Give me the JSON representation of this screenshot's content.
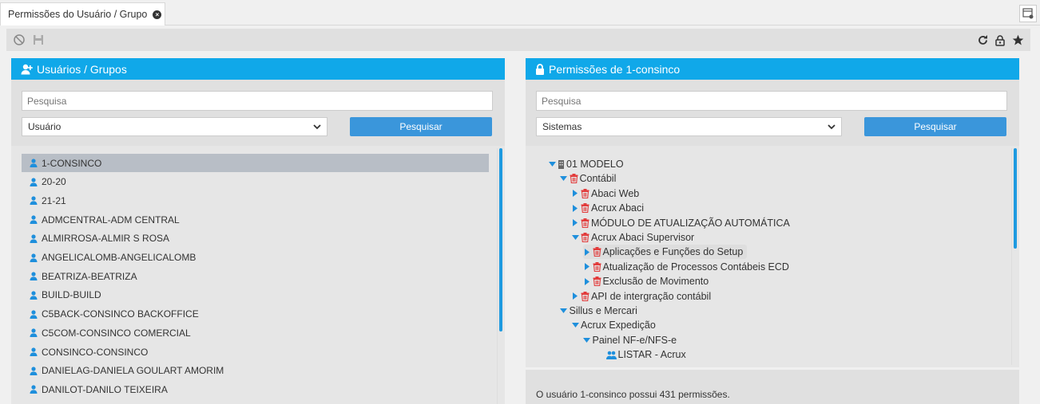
{
  "tab": {
    "title": "Permissões do Usuário / Grupo"
  },
  "left": {
    "title": "Usuários / Grupos",
    "search_placeholder": "Pesquisa",
    "select_value": "Usuário",
    "button": "Pesquisar",
    "users": [
      "1-CONSINCO",
      "20-20",
      "21-21",
      "ADMCENTRAL-ADM CENTRAL",
      "ALMIRROSA-ALMIR S ROSA",
      "ANGELICALOMB-ANGELICALOMB",
      "BEATRIZA-BEATRIZA",
      "BUILD-BUILD",
      "C5BACK-CONSINCO BACKOFFICE",
      "C5COM-CONSINCO COMERCIAL",
      "CONSINCO-CONSINCO",
      "DANIELAG-DANIELA GOULART AMORIM",
      "DANILOT-DANILO TEIXEIRA"
    ],
    "selected_index": 0
  },
  "right": {
    "title": "Permissões de 1-consinco",
    "search_placeholder": "Pesquisa",
    "select_value": "Sistemas",
    "button": "Pesquisar",
    "tree": [
      {
        "label": "01 MODELO",
        "depth": 0,
        "arrow": "down",
        "icon": "building-icon"
      },
      {
        "label": "Contábil",
        "depth": 1,
        "arrow": "down",
        "icon": "trash-icon"
      },
      {
        "label": "Abaci Web",
        "depth": 2,
        "arrow": "right",
        "icon": "trash-icon"
      },
      {
        "label": "Acrux Abaci",
        "depth": 2,
        "arrow": "right",
        "icon": "trash-icon"
      },
      {
        "label": "MÓDULO DE ATUALIZAÇÃO AUTOMÁTICA",
        "depth": 2,
        "arrow": "right",
        "icon": "trash-icon"
      },
      {
        "label": "Acrux Abaci Supervisor",
        "depth": 2,
        "arrow": "down",
        "icon": "trash-icon"
      },
      {
        "label": "Aplicações e Funções do Setup",
        "depth": 3,
        "arrow": "right",
        "icon": "trash-icon",
        "highlight": true
      },
      {
        "label": "Atualização de Processos Contábeis ECD",
        "depth": 3,
        "arrow": "right",
        "icon": "trash-icon"
      },
      {
        "label": "Exclusão de Movimento",
        "depth": 3,
        "arrow": "right",
        "icon": "trash-icon"
      },
      {
        "label": "API de intergração contábil",
        "depth": 2,
        "arrow": "right",
        "icon": "trash-icon"
      },
      {
        "label": "Sillus e Mercari",
        "depth": 1,
        "arrow": "down",
        "icon": ""
      },
      {
        "label": "Acrux Expedição",
        "depth": 2,
        "arrow": "down",
        "icon": ""
      },
      {
        "label": "Painel NF-e/NFS-e",
        "depth": 3,
        "arrow": "down",
        "icon": ""
      },
      {
        "label": "LISTAR - Acrux",
        "depth": 5,
        "arrow": "",
        "icon": "users-icon"
      }
    ],
    "footer": "O usuário 1-consinco possui 431 permissões."
  },
  "colors": {
    "header": "#10a8e9",
    "button": "#3a96db",
    "user_icon": "#1e8fdc",
    "trash": "#e23c3c"
  }
}
